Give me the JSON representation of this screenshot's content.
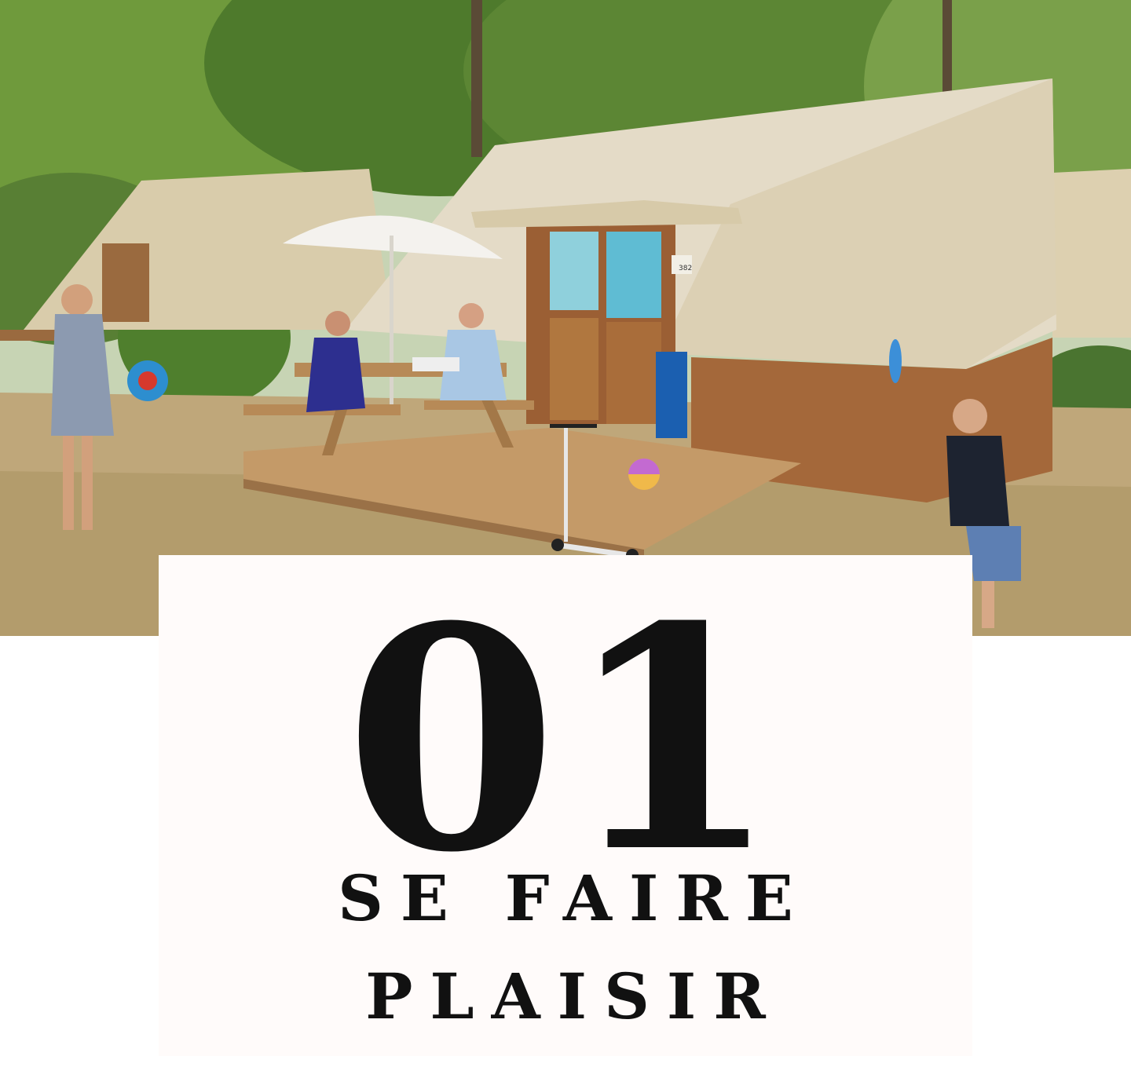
{
  "photo": {
    "scene": "family-camping-tent",
    "tent_sign": "382"
  },
  "section": {
    "number": "01",
    "title_line1": "SE FAIRE",
    "title_line2": "PLAISIR"
  },
  "colors": {
    "card_background": "#fffbfa",
    "text": "#111111",
    "canvas": "#e4dbc7",
    "wood": "#a4683a"
  }
}
